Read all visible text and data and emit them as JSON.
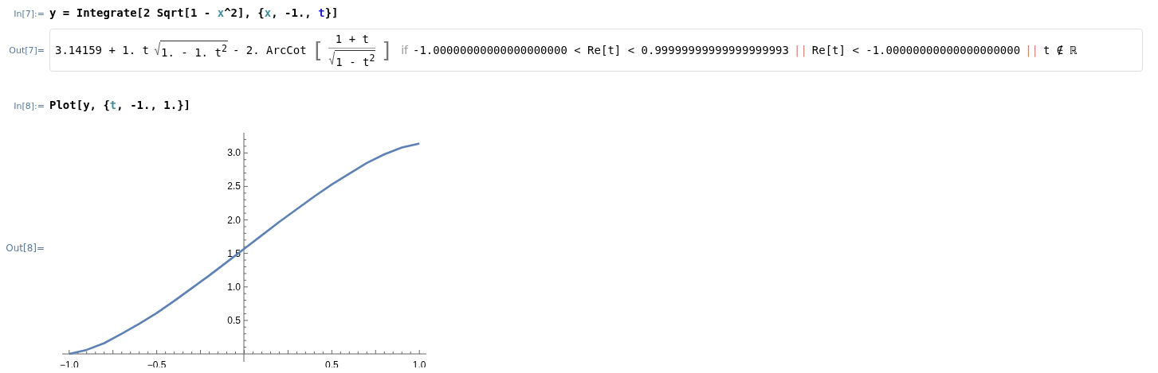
{
  "cells": [
    {
      "kind": "input",
      "label": "In[7]:=",
      "tokens": [
        {
          "text": "y = Integrate[2 Sqrt[1 - ",
          "kind": "code"
        },
        {
          "text": "x",
          "kind": "local"
        },
        {
          "text": "^2], {",
          "kind": "code"
        },
        {
          "text": "x",
          "kind": "local"
        },
        {
          "text": ", -1., ",
          "kind": "code"
        },
        {
          "text": "t",
          "kind": "symbol"
        },
        {
          "text": "}]",
          "kind": "code"
        }
      ]
    },
    {
      "kind": "formula",
      "label": "Out[7]=",
      "lead": "3.14159 + 1. t",
      "radicand": "1. - 1. t$^{2}$",
      "middle": "- 2. ArcCot",
      "open": "[",
      "numerator": "1 + t",
      "denominator": "1 - t$^{2}$",
      "close": "]",
      "keyword": "if",
      "conditions": [
        {
          "text": "-1.00000000000000000000 < Re[t] < 0.99999999999999999993"
        },
        {
          "separator": "||",
          "text": "Re[t] < -1.00000000000000000000"
        },
        {
          "separator": "||",
          "text": "t ∉ ℝ"
        }
      ]
    },
    {
      "kind": "input",
      "label": "In[8]:=",
      "tokens": [
        {
          "text": "Plot[y, {",
          "kind": "code"
        },
        {
          "text": "t",
          "kind": "local"
        },
        {
          "text": ", -1., 1.}]",
          "kind": "code"
        }
      ]
    },
    {
      "kind": "plot",
      "label": "Out[8]=",
      "chart_data": {
        "type": "line",
        "x": [
          -1,
          -0.9,
          -0.8,
          -0.7,
          -0.6,
          -0.5,
          -0.4,
          -0.3,
          -0.2,
          -0.1,
          0,
          0.1,
          0.2,
          0.3,
          0.4,
          0.5,
          0.6,
          0.7,
          0.8,
          0.9,
          1
        ],
        "series": [
          {
            "color": "#5e81b5",
            "values": [
              0,
              0.06,
              0.16,
              0.3,
              0.45,
              0.61,
              0.79,
              0.98,
              1.17,
              1.37,
              1.57,
              1.77,
              1.97,
              2.16,
              2.35,
              2.53,
              2.69,
              2.85,
              2.98,
              3.08,
              3.14
            ]
          }
        ],
        "xlim": [
          -1.04,
          1.04
        ],
        "ylim": [
          0,
          3.3
        ],
        "xticks": [
          {
            "value": -1,
            "label": "−1.0"
          },
          {
            "value": -0.5,
            "label": "−0.5"
          },
          {
            "value": 0.5,
            "label": "0.5"
          },
          {
            "value": 1,
            "label": "1.0"
          }
        ],
        "yticks": [
          0.5,
          {
            "value": 1,
            "label": "1.0"
          },
          1.5,
          {
            "value": 2,
            "label": "2.0"
          },
          2.5,
          {
            "value": 3,
            "label": "3.0"
          }
        ]
      }
    }
  ]
}
